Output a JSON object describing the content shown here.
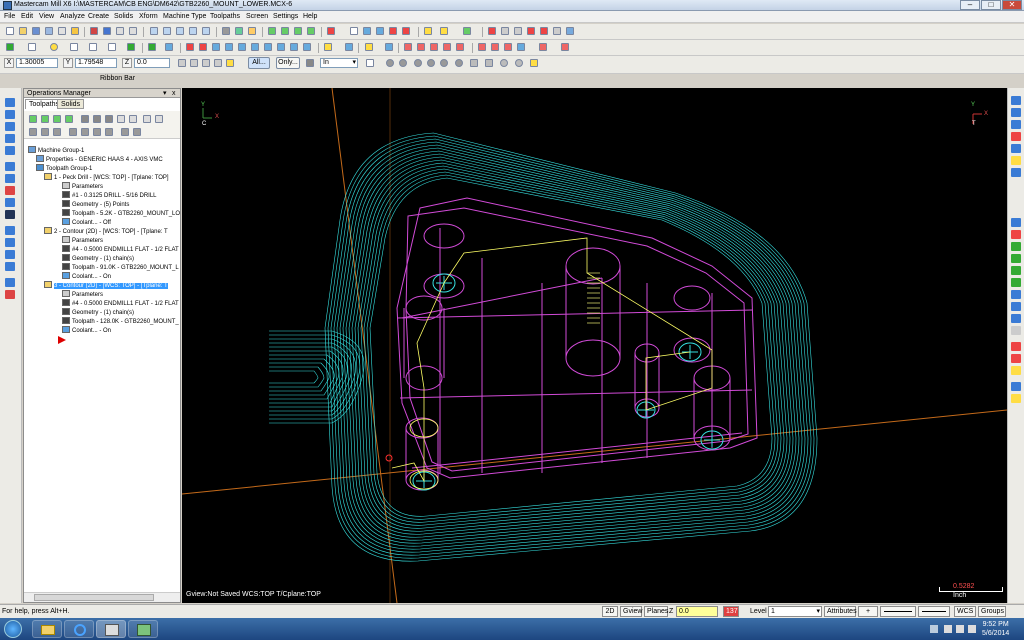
{
  "window": {
    "title": "Mastercam Mill X6  I:\\MASTERCAM\\CB ENG\\DM642\\GTB2260_MOUNT_LOWER.MCX-6",
    "minimize": "–",
    "maximize": "□",
    "close": "✕"
  },
  "menu": [
    "File",
    "Edit",
    "View",
    "Analyze",
    "Create",
    "Solids",
    "Xform",
    "Machine Type",
    "Toolpaths",
    "Screen",
    "Settings",
    "Help"
  ],
  "ribbon": {
    "x_label": "X",
    "x_value": "1.30005",
    "y_label": "Y",
    "y_value": "1.79548",
    "z_label": "Z",
    "z_value": "0.0",
    "all_button": "All...",
    "only_button": "Only...",
    "units_select": "In",
    "bar_label": "Ribbon Bar"
  },
  "ops_manager": {
    "title": "Operations Manager",
    "pin": "▾",
    "close": "x",
    "tabs": [
      "Toolpaths",
      "Solids"
    ],
    "active_tab": "Toolpaths",
    "tree": [
      {
        "level": 0,
        "text": "Machine Group-1",
        "icon": "machine-group-icon"
      },
      {
        "level": 1,
        "text": "Properties - GENERIC HAAS 4 - AXIS VMC",
        "icon": "properties-icon"
      },
      {
        "level": 1,
        "text": "Toolpath Group-1",
        "icon": "toolpath-group-icon"
      },
      {
        "level": 2,
        "text": "1 - Peck Drill - [WCS: TOP] - [Tplane: TOP]",
        "icon": "folder-icon"
      },
      {
        "level": 3,
        "text": "Parameters",
        "icon": "parameters-icon"
      },
      {
        "level": 3,
        "text": "#1 - 0.3125 DRILL  - 5/16 DRILL",
        "icon": "tool-icon"
      },
      {
        "level": 3,
        "text": "Geometry - (5) Points",
        "icon": "geometry-icon"
      },
      {
        "level": 3,
        "text": "Toolpath - 5.2K - GTB2260_MOUNT_LO",
        "icon": "toolpath-icon"
      },
      {
        "level": 3,
        "text": "Coolant... - Off",
        "icon": "coolant-icon"
      },
      {
        "level": 2,
        "text": "2 - Contour (2D) - [WCS: TOP] - [Tplane: T",
        "icon": "folder-icon"
      },
      {
        "level": 3,
        "text": "Parameters",
        "icon": "parameters-icon"
      },
      {
        "level": 3,
        "text": "#4 - 0.5000 ENDMILL1 FLAT - 1/2 FLAT",
        "icon": "tool-icon"
      },
      {
        "level": 3,
        "text": "Geometry - (1) chain(s)",
        "icon": "geometry-icon"
      },
      {
        "level": 3,
        "text": "Toolpath - 91.0K - GTB2260_MOUNT_L",
        "icon": "toolpath-icon"
      },
      {
        "level": 3,
        "text": "Coolant... - On",
        "icon": "coolant-icon"
      },
      {
        "level": 2,
        "text": "3 - Contour (2D) - [WCS: TOP] - [Tplane: T",
        "icon": "folder-icon",
        "selected": true
      },
      {
        "level": 3,
        "text": "Parameters",
        "icon": "parameters-icon"
      },
      {
        "level": 3,
        "text": "#4 - 0.5000 ENDMILL1 FLAT - 1/2 FLAT",
        "icon": "tool-icon"
      },
      {
        "level": 3,
        "text": "Geometry - (1) chain(s)",
        "icon": "geometry-icon"
      },
      {
        "level": 3,
        "text": "Toolpath - 128.0K - GTB2260_MOUNT_",
        "icon": "toolpath-icon"
      },
      {
        "level": 3,
        "text": "Coolant... - On",
        "icon": "coolant-icon"
      }
    ]
  },
  "viewport": {
    "status_text": "Gview:Not Saved   WCS:TOP   T/Cplane:TOP",
    "axis_left_y": "Y",
    "axis_left_c": "C",
    "axis_left_x": "X",
    "axis_right_y": "Y",
    "axis_right_t": "T",
    "axis_right_x": "X",
    "scale_value": "0.5282",
    "scale_unit": "Inch"
  },
  "statusbar": {
    "help": "For help, press Alt+H.",
    "mode_2d": "2D",
    "gview": "Gview",
    "planes": "Planes",
    "z_label": "Z",
    "z_value": "0.0",
    "color_value": "137",
    "level_label": "Level",
    "level_value": "1",
    "attributes": "Attributes",
    "wcs": "WCS",
    "groups": "Groups"
  },
  "taskbar": {
    "time": "9:52 PM",
    "date": "5/6/2014"
  },
  "colors": {
    "toolpath_cyan": "#36e0e0",
    "wireframe_magenta": "#d24bd8",
    "highlight_yellow": "#ffff66",
    "selection_blue": "#3399ff"
  }
}
